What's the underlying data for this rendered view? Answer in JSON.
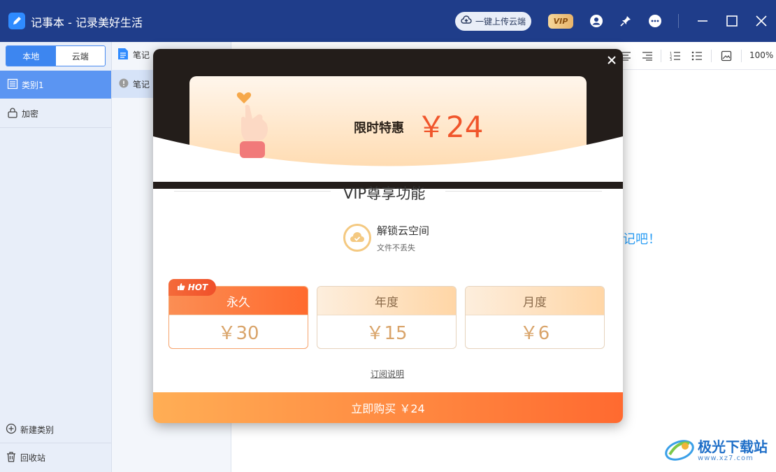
{
  "window": {
    "title": "记事本 - 记录美好生活",
    "upload_label": "一键上传云端",
    "vip_label": "VIP"
  },
  "sidebar": {
    "tabs": [
      {
        "label": "本地",
        "active": true
      },
      {
        "label": "云端",
        "active": false
      }
    ],
    "categories": [
      {
        "label": "类别1",
        "active": true
      },
      {
        "label": "加密",
        "active": false
      }
    ],
    "new_category_label": "新建类别",
    "recycle_label": "回收站"
  },
  "notelist": {
    "header": "笔记",
    "item": "笔记"
  },
  "editor": {
    "zoom": "100%",
    "hint_text": "记吧！"
  },
  "modal": {
    "promo_label": "限时特惠",
    "promo_price": "￥24",
    "section_title": "VIP尊享功能",
    "feature": {
      "title": "解锁云空间",
      "subtitle": "文件不丢失"
    },
    "hot_label": "HOT",
    "plans": [
      {
        "name": "永久",
        "price": "￥30",
        "selected": true
      },
      {
        "name": "年度",
        "price": "￥15",
        "selected": false
      },
      {
        "name": "月度",
        "price": "￥6",
        "selected": false
      }
    ],
    "subscription_link": "订阅说明",
    "buy_label": "立即购买 ￥24"
  },
  "watermark": {
    "name": "极光下载站",
    "url": "www.xz7.com"
  },
  "colors": {
    "titlebar": "#1f3d8a",
    "accent": "#3d86f0",
    "price": "#f0552b",
    "buy_start": "#ffae55",
    "buy_end": "#ff6a30"
  }
}
